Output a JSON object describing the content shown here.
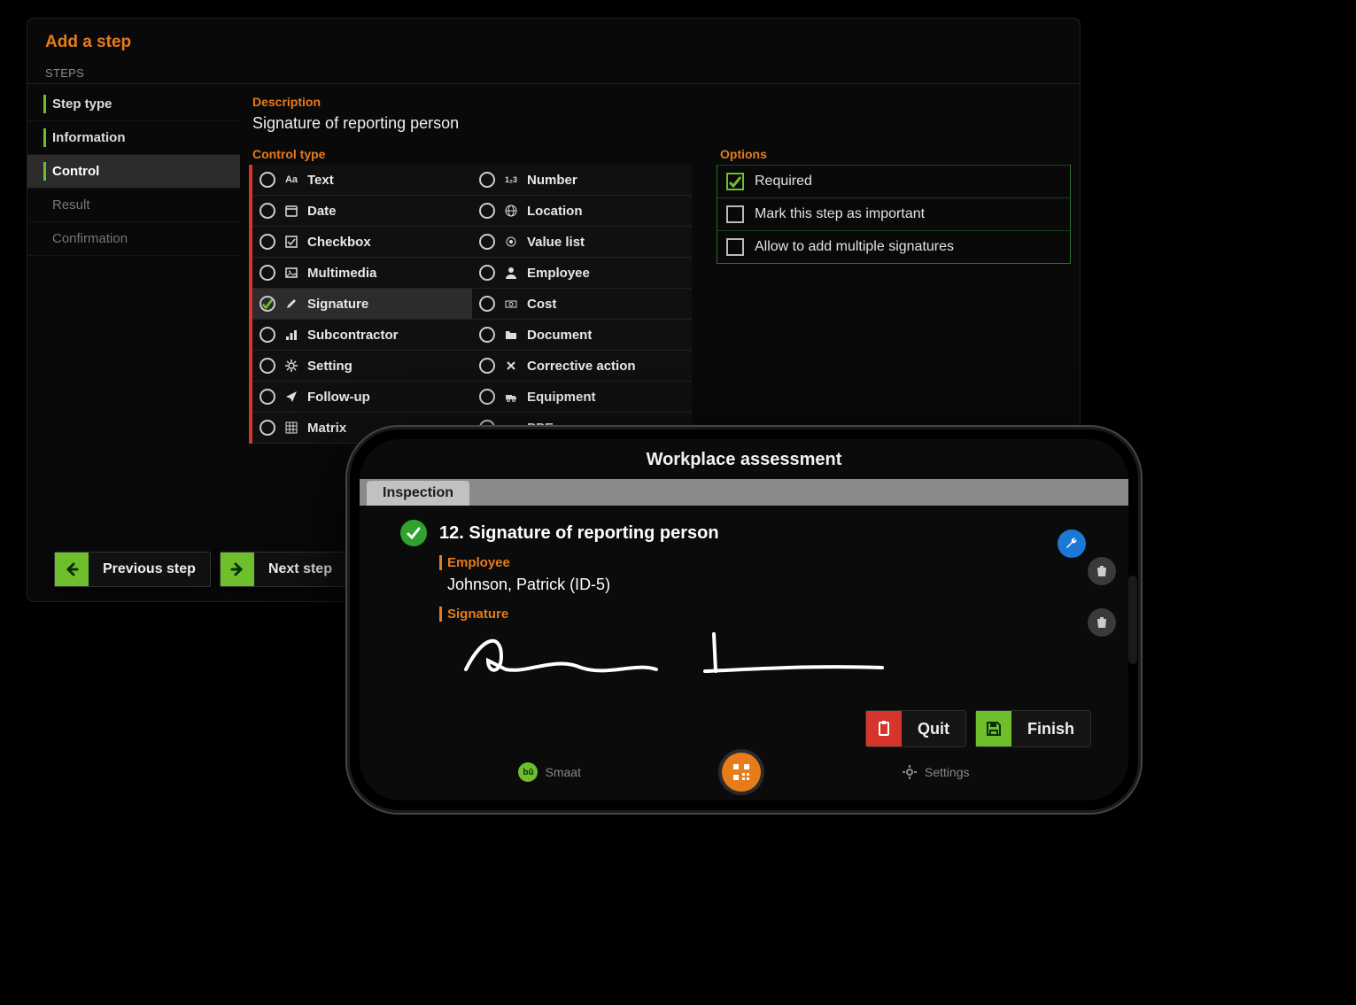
{
  "desktop": {
    "title": "Add a step",
    "steps_header": "STEPS",
    "sidebar": [
      {
        "label": "Step type",
        "state": "past"
      },
      {
        "label": "Information",
        "state": "past"
      },
      {
        "label": "Control",
        "state": "active"
      },
      {
        "label": "Result",
        "state": "future"
      },
      {
        "label": "Confirmation",
        "state": "future"
      }
    ],
    "description_label": "Description",
    "description_value": "Signature of reporting person",
    "control_type_label": "Control type",
    "control_types_col1": [
      {
        "label": "Text",
        "icon": "Aa",
        "selected": false
      },
      {
        "label": "Date",
        "icon": "calendar",
        "selected": false
      },
      {
        "label": "Checkbox",
        "icon": "check-square",
        "selected": false
      },
      {
        "label": "Multimedia",
        "icon": "image",
        "selected": false
      },
      {
        "label": "Signature",
        "icon": "pen",
        "selected": true
      },
      {
        "label": "Subcontractor",
        "icon": "org",
        "selected": false
      },
      {
        "label": "Setting",
        "icon": "gear",
        "selected": false
      },
      {
        "label": "Follow-up",
        "icon": "send",
        "selected": false
      },
      {
        "label": "Matrix",
        "icon": "grid",
        "selected": false
      }
    ],
    "control_types_col2": [
      {
        "label": "Number",
        "icon": "123",
        "selected": false
      },
      {
        "label": "Location",
        "icon": "globe",
        "selected": false
      },
      {
        "label": "Value list",
        "icon": "dot",
        "selected": false
      },
      {
        "label": "Employee",
        "icon": "user",
        "selected": false
      },
      {
        "label": "Cost",
        "icon": "money",
        "selected": false
      },
      {
        "label": "Document",
        "icon": "folder",
        "selected": false
      },
      {
        "label": "Corrective action",
        "icon": "tools",
        "selected": false
      },
      {
        "label": "Equipment",
        "icon": "truck",
        "selected": false
      },
      {
        "label": "PPE",
        "icon": "helmet",
        "selected": false
      }
    ],
    "options_label": "Options",
    "options": [
      {
        "label": "Required",
        "checked": true
      },
      {
        "label": "Mark this step as important",
        "checked": false
      },
      {
        "label": "Allow to add multiple signatures",
        "checked": false
      }
    ],
    "prev_label": "Previous step",
    "next_label": "Next step"
  },
  "phone": {
    "header": "Workplace assessment",
    "tab": "Inspection",
    "step_title": "12. Signature of reporting person",
    "employee_label": "Employee",
    "employee_value": "Johnson, Patrick (ID-5)",
    "signature_label": "Signature",
    "quit_label": "Quit",
    "finish_label": "Finish",
    "nav_app": "Smaat",
    "nav_settings": "Settings"
  }
}
